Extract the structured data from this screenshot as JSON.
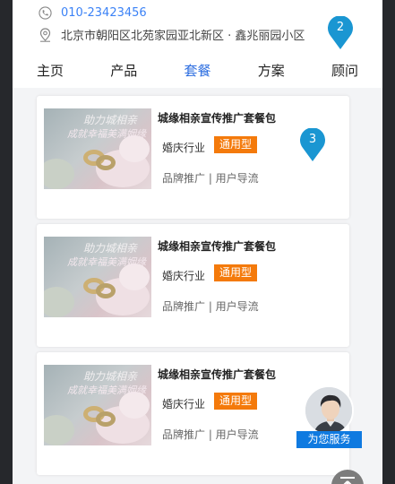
{
  "contact": {
    "phone": "010-23423456",
    "address": "北京市朝阳区北苑家园亚北新区 · 鑫兆丽园小区"
  },
  "badges": {
    "address_marker": "2",
    "card_marker": "3"
  },
  "nav": {
    "tabs": [
      "主页",
      "产品",
      "套餐",
      "方案",
      "顾问"
    ],
    "active": "套餐"
  },
  "packages": [
    {
      "image_text_line1": "助力城相亲",
      "image_text_line2": "成就幸福美满姻缘",
      "title": "城缘相亲宣传推广套餐包",
      "industry": "婚庆行业",
      "tag": "通用型",
      "desc": "品牌推广 | 用户导流"
    },
    {
      "image_text_line1": "助力城相亲",
      "image_text_line2": "成就幸福美满姻缘",
      "title": "城缘相亲宣传推广套餐包",
      "industry": "婚庆行业",
      "tag": "通用型",
      "desc": "品牌推广 | 用户导流"
    },
    {
      "image_text_line1": "助力城相亲",
      "image_text_line2": "成就幸福美满姻缘",
      "title": "城缘相亲宣传推广套餐包",
      "industry": "婚庆行业",
      "tag": "通用型",
      "desc": "品牌推广 | 用户导流"
    }
  ],
  "service": {
    "label": "为您服务"
  },
  "colors": {
    "accent": "#2f6fe0",
    "tag": "#f47a0b",
    "marker": "#1a96d2",
    "service": "#0f7ae0"
  }
}
